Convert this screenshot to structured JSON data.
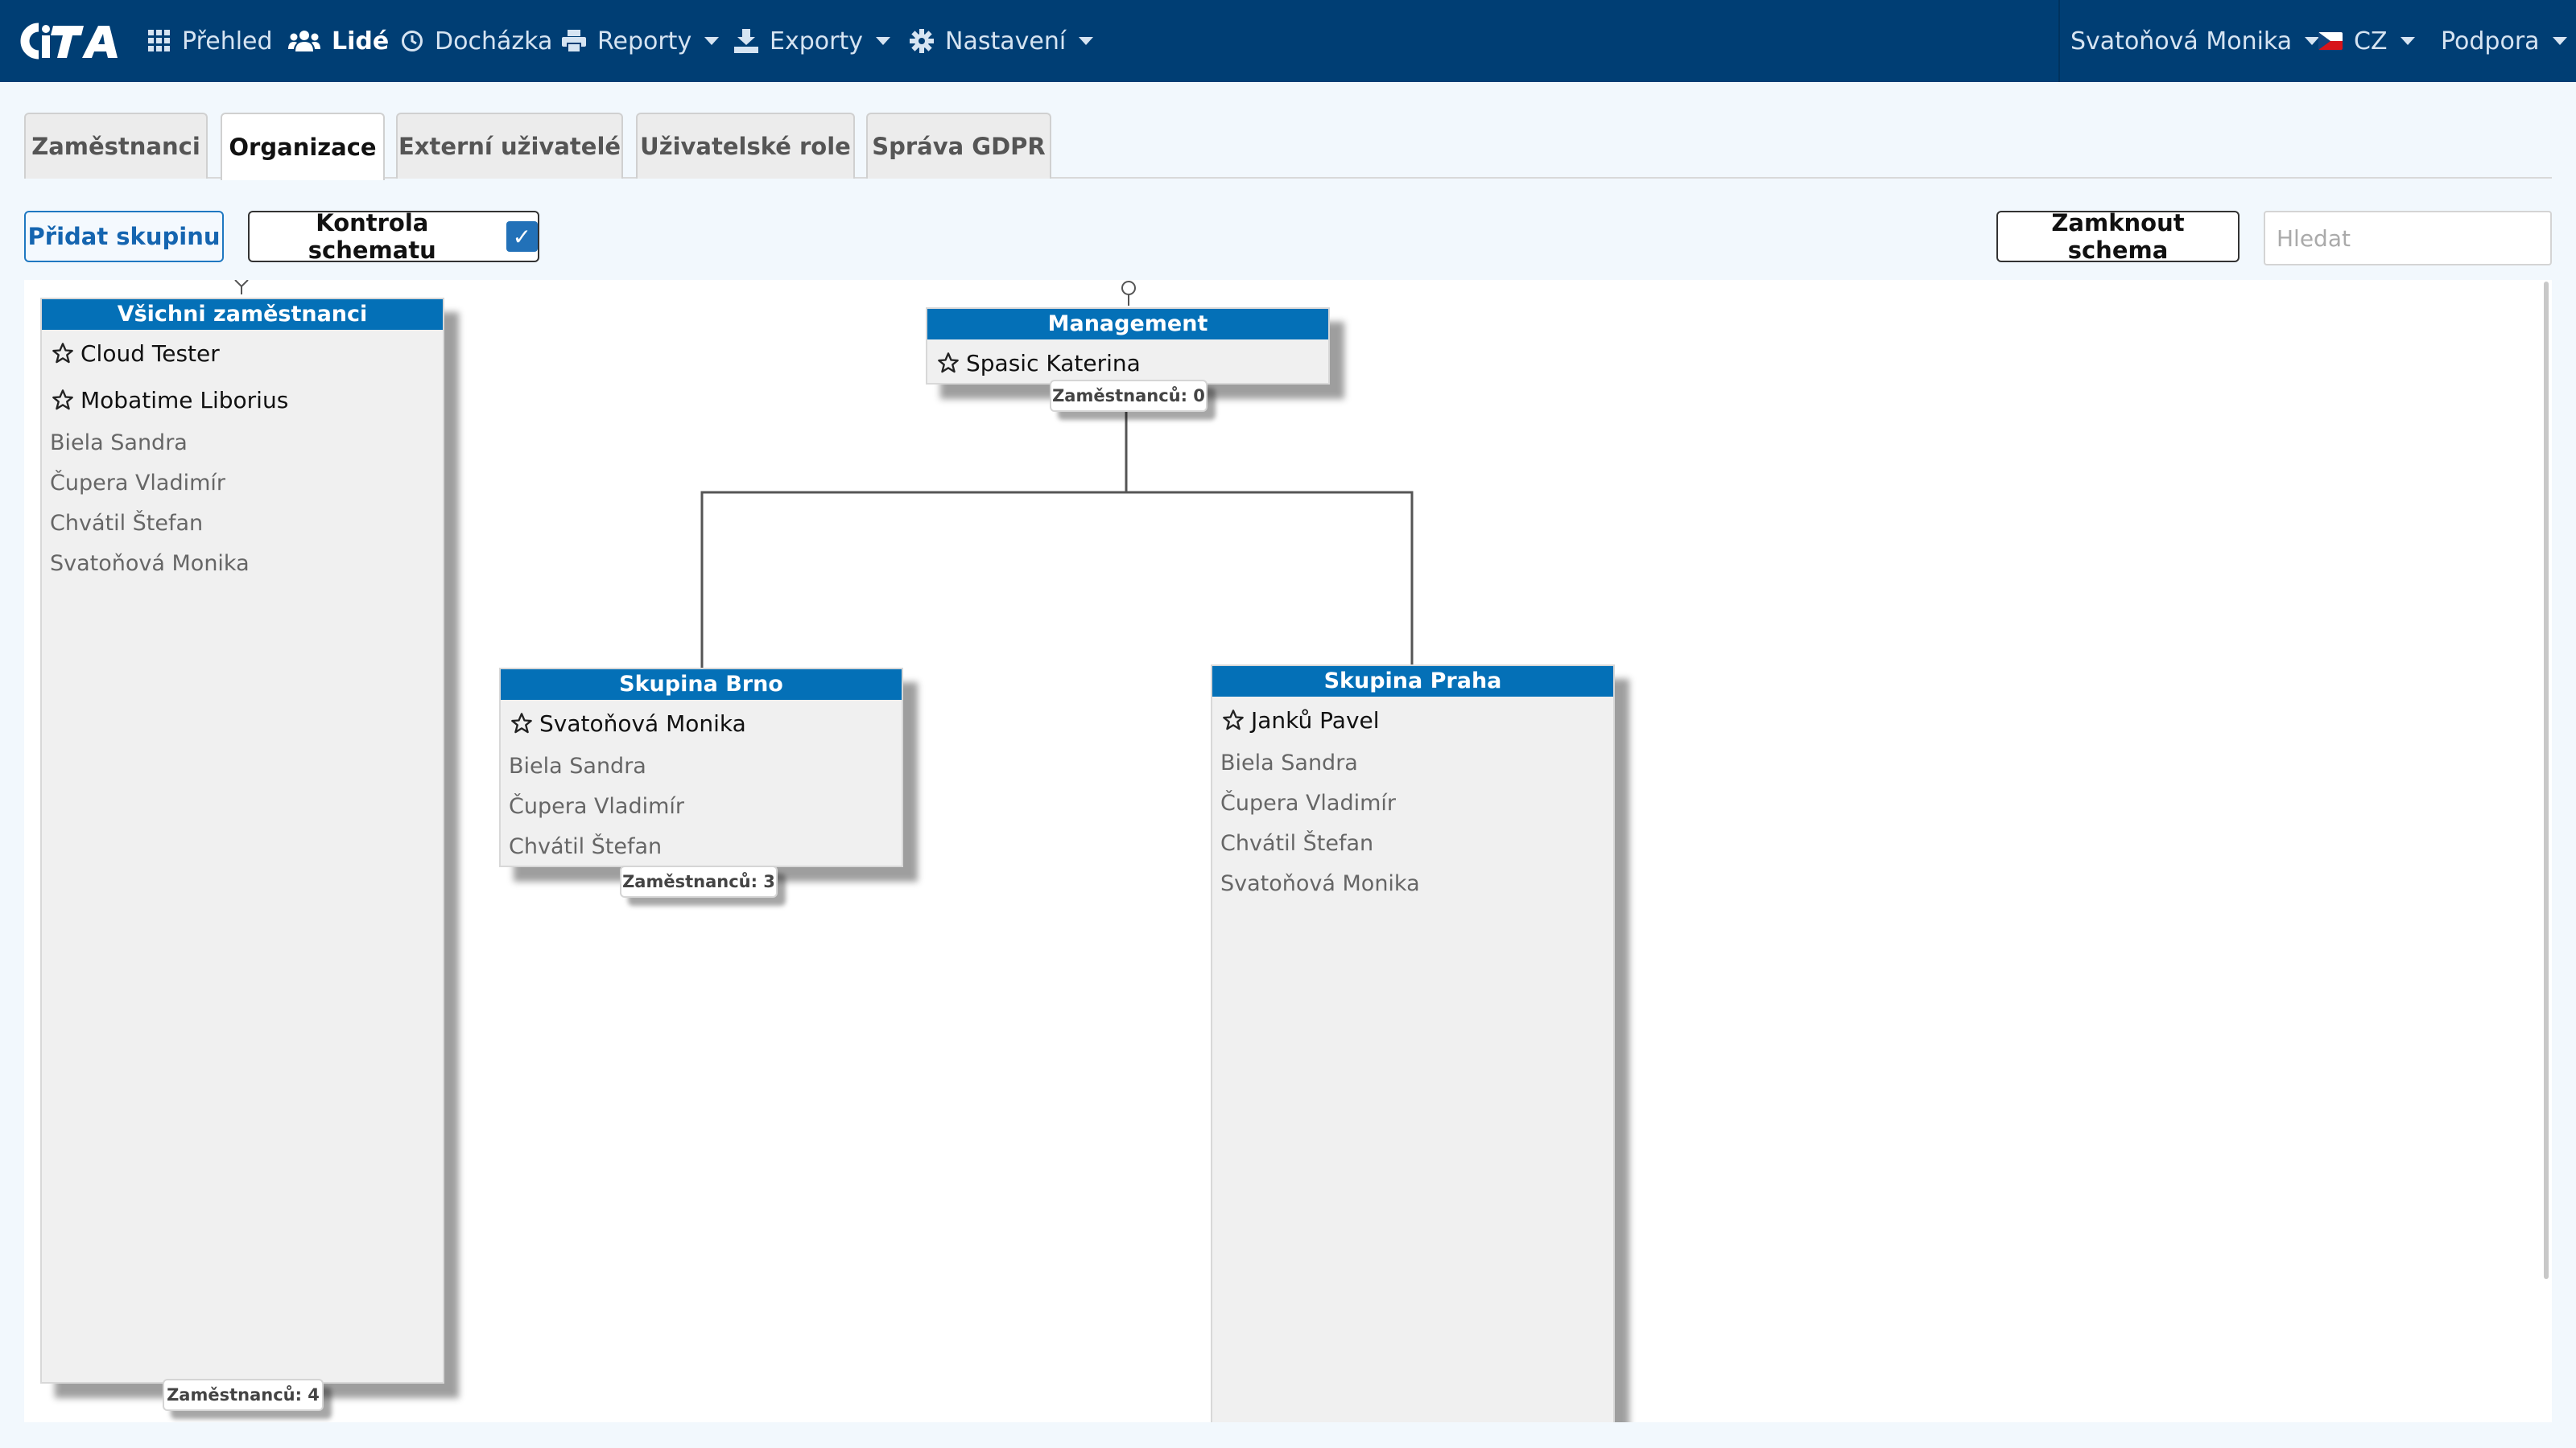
{
  "app": {
    "logo_text": "CiTA",
    "brand_color": "#003e74",
    "accent_color": "#0470b7"
  },
  "nav": {
    "items": [
      {
        "label": "Přehled",
        "icon": "grid-icon"
      },
      {
        "label": "Lidé",
        "icon": "users-icon",
        "active": true
      },
      {
        "label": "Docházka",
        "icon": "clock-icon"
      },
      {
        "label": "Reporty",
        "icon": "printer-icon",
        "dropdown": true
      },
      {
        "label": "Exporty",
        "icon": "export-icon",
        "dropdown": true
      },
      {
        "label": "Nastavení",
        "icon": "gear-icon",
        "dropdown": true
      }
    ],
    "user": "Svatoňová Monika",
    "language": "CZ",
    "support": "Podpora"
  },
  "tabs": [
    {
      "label": "Zaměstnanci"
    },
    {
      "label": "Organizace",
      "active": true
    },
    {
      "label": "Externí uživatelé"
    },
    {
      "label": "Uživatelské role"
    },
    {
      "label": "Správa GDPR"
    }
  ],
  "toolbar": {
    "add_group": "Přidat skupinu",
    "schema_check": "Kontrola schematu",
    "schema_check_checked": true,
    "lock_schema": "Zamknout schema",
    "search_placeholder": "Hledat"
  },
  "groups": {
    "all": {
      "title": "Všichni zaměstnanci",
      "leaders": [
        "Cloud Tester",
        "Mobatime Liborius"
      ],
      "members": [
        "Biela Sandra",
        "Čupera Vladimír",
        "Chvátil Štefan",
        "Svatoňová Monika"
      ],
      "count": "Zaměstnanců: 4"
    },
    "management": {
      "title": "Management",
      "leaders": [
        "Spasic Katerina"
      ],
      "members": [],
      "count": "Zaměstnanců: 0"
    },
    "brno": {
      "title": "Skupina Brno",
      "leaders": [
        "Svatoňová Monika"
      ],
      "members": [
        "Biela Sandra",
        "Čupera Vladimír",
        "Chvátil Štefan"
      ],
      "count": "Zaměstnanců: 3"
    },
    "praha": {
      "title": "Skupina Praha",
      "leaders": [
        "Janků Pavel"
      ],
      "members": [
        "Biela Sandra",
        "Čupera Vladimír",
        "Chvátil Štefan",
        "Svatoňová Monika"
      ]
    }
  }
}
